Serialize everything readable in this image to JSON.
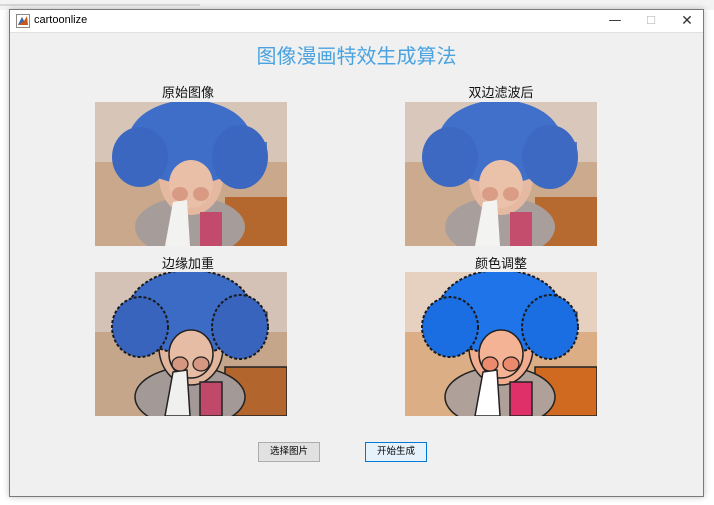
{
  "window": {
    "title": "cartoonlize",
    "icon": "matlab-icon",
    "controls": {
      "minimize": "—",
      "maximize": "☐",
      "close": "✕"
    }
  },
  "main": {
    "heading": "图像漫画特效生成算法",
    "panels": [
      {
        "label": "原始图像",
        "style": "original"
      },
      {
        "label": "双边滤波后",
        "style": "bilateral"
      },
      {
        "label": "边缘加重",
        "style": "edges"
      },
      {
        "label": "颜色调整",
        "style": "color"
      }
    ]
  },
  "buttons": {
    "select_image": "选择图片",
    "start_generate": "开始生成"
  },
  "colors": {
    "heading": "#4aa3df",
    "wig_blue": "#3f6ec9",
    "wig_blue_bright": "#1e74e8",
    "background": "#f0f0f0"
  }
}
